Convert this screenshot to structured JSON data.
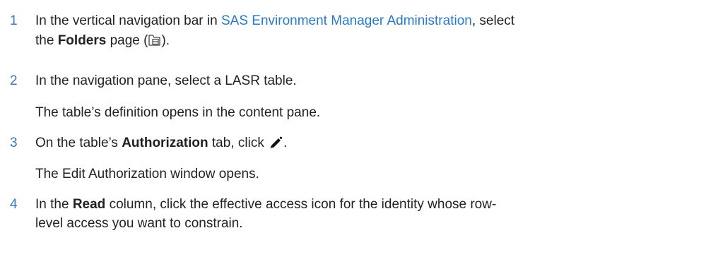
{
  "steps": [
    {
      "number": "1",
      "line1_before_link": "In the vertical navigation bar in ",
      "line1_link": "SAS Environment Manager Administration",
      "line1_after_link": ", select",
      "line2_before_bold": "the ",
      "line2_bold": "Folders",
      "line2_after_bold_1": " page (",
      "line2_after_icon": ").",
      "icon": "folders-icon"
    },
    {
      "number": "2",
      "text": "In the navigation pane, select a LASR table.",
      "note": "The table’s definition opens in the content pane."
    },
    {
      "number": "3",
      "text_before_bold": "On the table’s ",
      "bold": "Authorization",
      "text_after_bold": " tab, click ",
      "text_end": ".",
      "icon": "pencil-icon",
      "note": "The Edit Authorization window opens."
    },
    {
      "number": "4",
      "line1_before_bold": "In the ",
      "line1_bold": "Read",
      "line1_after_bold": " column, click the effective access icon for the identity whose row-",
      "line2": "level access you want to constrain."
    }
  ],
  "colors": {
    "step_number": "#3a78b5",
    "link": "#2a7ac4",
    "text": "#222222"
  }
}
